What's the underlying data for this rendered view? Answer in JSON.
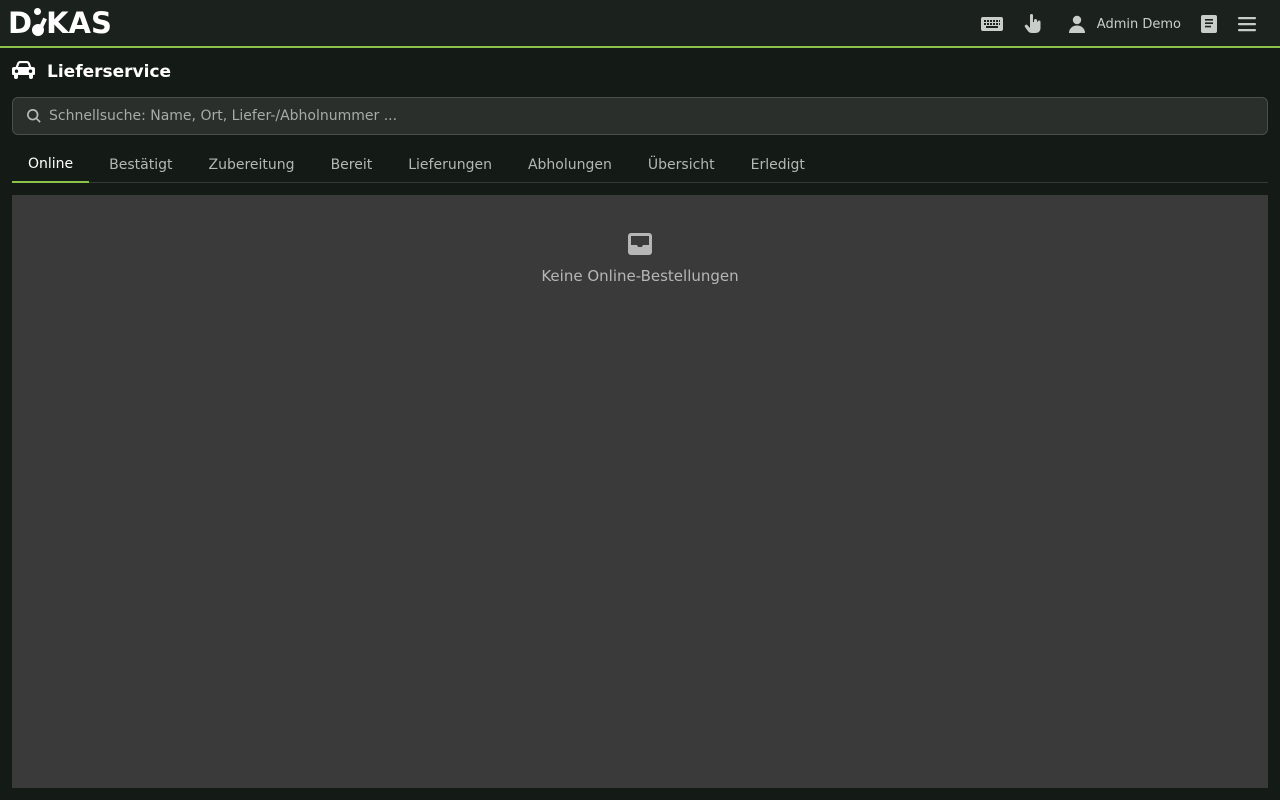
{
  "header": {
    "logo_text": "DiKAS",
    "user_name": "Admin Demo",
    "icons": [
      "keyboard-icon",
      "touch-icon",
      "user-icon",
      "book-icon",
      "menu-icon"
    ]
  },
  "page": {
    "title": "Lieferservice",
    "title_icon": "car-icon"
  },
  "search": {
    "placeholder": "Schnellsuche: Name, Ort, Liefer-/Abholnummer ...",
    "value": ""
  },
  "tabs": [
    {
      "label": "Online",
      "active": true
    },
    {
      "label": "Bestätigt"
    },
    {
      "label": "Zubereitung"
    },
    {
      "label": "Bereit"
    },
    {
      "label": "Lieferungen"
    },
    {
      "label": "Abholungen"
    },
    {
      "label": "Übersicht"
    },
    {
      "label": "Erledigt"
    }
  ],
  "content": {
    "empty_icon": "inbox-icon",
    "empty_text": "Keine Online-Bestellungen"
  },
  "colors": {
    "accent": "#8bc34a",
    "background": "#141a16",
    "panel": "#3a3a3a"
  }
}
